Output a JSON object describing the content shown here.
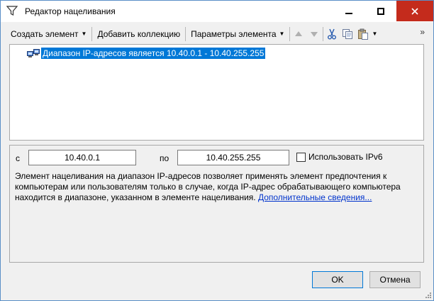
{
  "window": {
    "title": "Редактор нацеливания"
  },
  "toolbar": {
    "create_element": "Создать элемент",
    "add_collection": "Добавить коллекцию",
    "element_params": "Параметры элемента",
    "more": "»"
  },
  "tree": {
    "items": [
      {
        "label": "Диапазон IP-адресов является 10.40.0.1 - 10.40.255.255",
        "selected": true
      }
    ]
  },
  "props": {
    "from_label": "с",
    "from_value": "10.40.0.1",
    "to_label": "по",
    "to_value": "10.40.255.255",
    "ipv6_label": "Использовать IPv6",
    "ipv6_checked": false,
    "description_line1": "Элемент нацеливания на диапазон IP-адресов позволяет применять элемент предпочтения к",
    "description_line2": "компьютерам или пользователям только в случае, когда IP-адрес обрабатывающего компьютера",
    "description_line3": "находится в диапазоне, указанном в элементе нацеливания.",
    "more_info_link": "Дополнительные сведения..."
  },
  "buttons": {
    "ok": "OK",
    "cancel": "Отмена"
  },
  "colors": {
    "selection": "#0078d7",
    "close_button": "#c42b1c",
    "link": "#0033cc"
  }
}
